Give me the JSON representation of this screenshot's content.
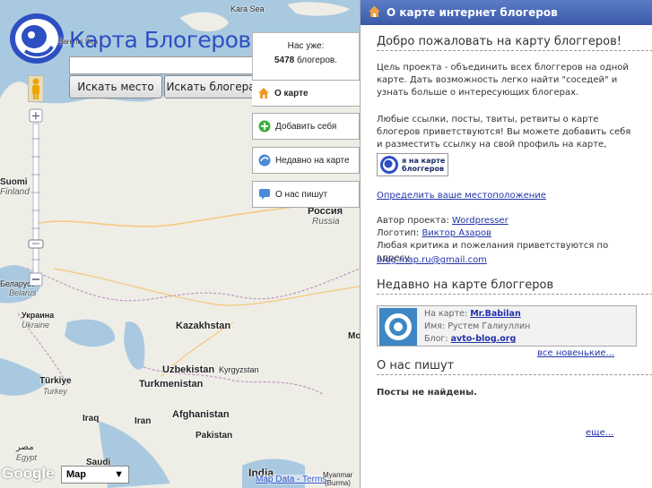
{
  "app": {
    "logo_text": "Карта Блогеров",
    "search_placeholder": "",
    "search_place_label": "Искать место",
    "search_blogger_label": "Искать блогера",
    "counter_prefix": "Нас уже:",
    "counter_value": "5478",
    "counter_suffix": "блогеров."
  },
  "menu": [
    {
      "label": "О карте",
      "icon": "home-icon"
    },
    {
      "label": "Добавить себя",
      "icon": "plus-icon"
    },
    {
      "label": "Недавно на карте",
      "icon": "recent-icon"
    },
    {
      "label": "О нас пишут",
      "icon": "speech-bubble-icon"
    }
  ],
  "map": {
    "map_type": "Map",
    "google_logo": "Google",
    "map_data": "Map Data - Terms",
    "labels": {
      "kara_sea": "Kara Sea",
      "barents": "Barents Sea",
      "suomi": "Suomi",
      "finland": "Finland",
      "rossiya": "Россия",
      "russia": "Russia",
      "belarus": "Беларусь",
      "belarus_en": "Belarus",
      "ukraina": "Украина",
      "ukraine": "Ukraine",
      "kazakhstan": "Kazakhstan",
      "uzbekistan": "Uzbekistan",
      "kyrgyzstan": "Kyrgyzstan",
      "turkmenistan": "Turkmenistan",
      "turkiye": "Türkiye",
      "turkey": "Turkey",
      "iraq": "Iraq",
      "iran": "Iran",
      "afghanistan": "Afghanistan",
      "pakistan": "Pakistan",
      "india": "India",
      "saudi": "Saudi",
      "egypt_ar": "مصر",
      "egypt": "Egypt",
      "myanmar": "Myanmar",
      "burma": "(Burma)",
      "mo": "Mo"
    }
  },
  "sidebar": {
    "header_title": "О карте интернет блогеров",
    "welcome_title": "Добро пожаловать на карту блоггеров!",
    "intro": "Цель проекта - объединить всех блоггеров на одной карте. Дать возможность легко найти \"соседей\" и узнать больше о интересующих блогерах.",
    "links_text": "Любые ссылки, посты, твиты, ретвиты о карте блогеров приветствуются! Вы можете добавить себя и разместить ссылку на свой профиль на карте, например так:",
    "badge_line1": "я на карте",
    "badge_line2": "блоггеров",
    "locate_link": "Определить ваше местоположение",
    "author_label": "Автор проекта:",
    "author_link": "Wordpresser",
    "logo_label": "Логотип:",
    "logo_link": "Виктор Азаров",
    "critique": "Любая критика и пожелания приветствуются по адресу",
    "email": "blog.map.ru@gmail.com",
    "recent_title": "Недавно на карте блоггеров",
    "recent_map_label": "На карте:",
    "recent_map_value": "Mr.Babilan",
    "recent_name_label": "Имя:",
    "recent_name_value": "Рустем Галиуллин",
    "recent_blog_label": "Блог:",
    "recent_blog_value": "avto-blog.org",
    "all_new_link": "все новенькие...",
    "press_title": "О нас пишут",
    "no_posts": "Посты не найдены.",
    "more_link": "еще..."
  },
  "colors": {
    "header_blue": "#3a5aa8",
    "link": "#2233aa",
    "water": "#a9c9e0",
    "land": "#eeede6"
  }
}
